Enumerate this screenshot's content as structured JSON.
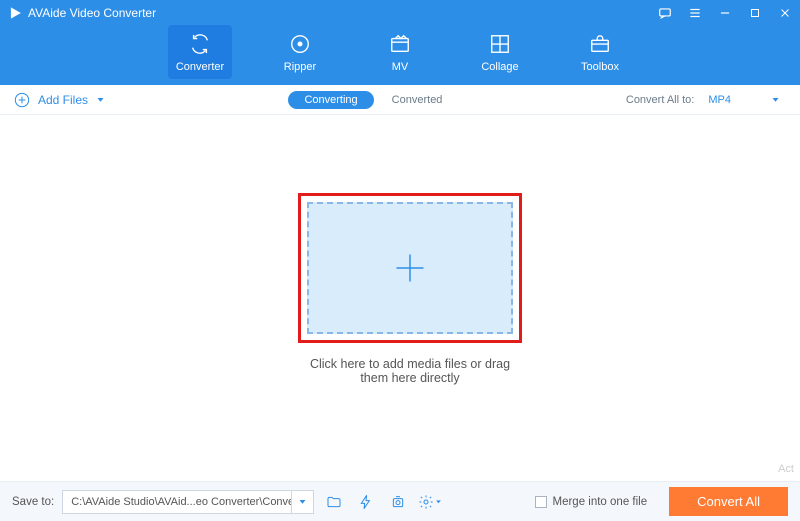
{
  "app": {
    "title": "AVAide Video Converter"
  },
  "winControls": {
    "feedback": "feedback-icon",
    "menu": "menu-icon",
    "minimize": "minimize-icon",
    "maximize": "maximize-icon",
    "close": "close-icon"
  },
  "tabs": {
    "converter": "Converter",
    "ripper": "Ripper",
    "mv": "MV",
    "collage": "Collage",
    "toolbox": "Toolbox"
  },
  "subbar": {
    "addFiles": "Add Files",
    "converting": "Converting",
    "converted": "Converted",
    "convertAllTo": "Convert All to:",
    "format": "MP4"
  },
  "dropzone": {
    "instruction": "Click here to add media files or drag them here directly"
  },
  "footer": {
    "saveToLabel": "Save to:",
    "savePath": "C:\\AVAide Studio\\AVAid...eo Converter\\Converted",
    "mergeLabel": "Merge into one file",
    "convertBtn": "Convert All"
  },
  "watermark": "Act",
  "colors": {
    "brand": "#2d8ee8",
    "accent": "#ff7a33",
    "highlight": "#e21b1b"
  }
}
